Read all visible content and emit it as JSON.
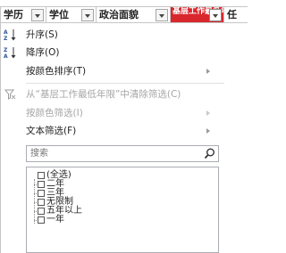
{
  "sheet_header": {
    "columns": [
      "学历",
      "学位",
      "政治面貌",
      "基层工作最低年限"
    ],
    "partial_column": "任"
  },
  "menu": {
    "sort_asc": "升序(S)",
    "sort_desc": "降序(O)",
    "sort_by_color": "按颜色排序(T)",
    "clear_filter": "从“基层工作最低年限”中清除筛选(C)",
    "filter_by_color": "按颜色筛选(I)",
    "text_filters": "文本筛选(F)"
  },
  "search": {
    "placeholder": "搜索"
  },
  "filter_values": [
    "(全选)",
    "二年",
    "三年",
    "无限制",
    "五年以上",
    "一年"
  ],
  "colors": {
    "active_header": "#d9272e",
    "sort_up_arrow": "#2f5597",
    "sort_down_arrow": "#2f5597",
    "disabled_text": "#a6a6a6"
  }
}
